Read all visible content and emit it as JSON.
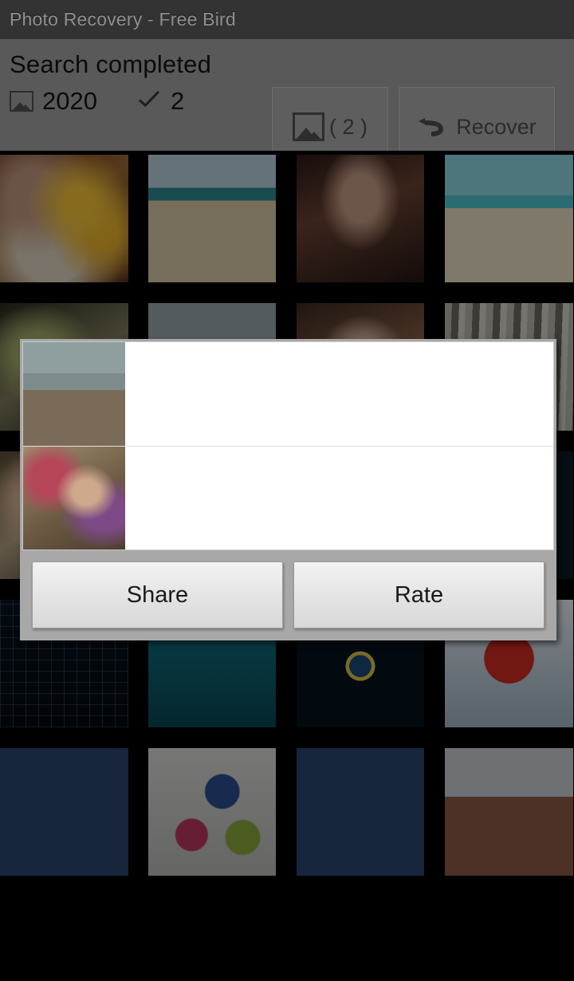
{
  "titlebar": {
    "title": "Photo Recovery - Free Bird"
  },
  "toolbar": {
    "status_line": "Search completed",
    "photo_icon": "image-icon",
    "photo_count": "2020",
    "check_icon": "check-icon",
    "selected_count": "2",
    "select_button": {
      "icon": "image-icon",
      "label": "( 2 )"
    },
    "recover_button": {
      "icon": "undo-arrow-icon",
      "label": "Recover"
    },
    "background_color": "#595959",
    "titlebar_color": "#333333"
  },
  "dialog": {
    "rows": [
      {
        "thumb_alt": "woman-in-black-dress-by-water",
        "text": ""
      },
      {
        "thumb_alt": "woman-reclining-indoors",
        "text": ""
      }
    ],
    "buttons": [
      {
        "label": "Share"
      },
      {
        "label": "Rate"
      }
    ],
    "frame_color": "#a8a8a8",
    "content_color": "#ffffff"
  },
  "grid": {
    "columns": 4,
    "cells": [
      {
        "alt": "mother-and-baby-autumn",
        "dimmed": false
      },
      {
        "alt": "woman-on-beach",
        "dimmed": false
      },
      {
        "alt": "woman-portrait-dark-hair",
        "dimmed": false
      },
      {
        "alt": "mother-and-baby-tropical-beach",
        "dimmed": false
      },
      {
        "alt": "blonde-woman-outdoors",
        "dimmed": true
      },
      {
        "alt": "woman-with-camera",
        "dimmed": true
      },
      {
        "alt": "woman-portrait-closeup",
        "dimmed": true
      },
      {
        "alt": "metal-pipes-texture",
        "dimmed": true
      },
      {
        "alt": "smiling-woman-portrait",
        "dimmed": true
      },
      {
        "alt": "woman-in-black-top",
        "dimmed": true
      },
      {
        "alt": "fitness-stats-1000-screen",
        "dimmed": true
      },
      {
        "alt": "app-icon-dark-globe-champion",
        "dimmed": true
      },
      {
        "alt": "signal-graph-screenshot",
        "dimmed": true
      },
      {
        "alt": "fitness-stats-938-screen",
        "dimmed": true
      },
      {
        "alt": "fitness-globe-dial-screen",
        "dimmed": true
      },
      {
        "alt": "china-railway-app-icon",
        "dimmed": true
      },
      {
        "alt": "music-note-app-icon",
        "dimmed": true
      },
      {
        "alt": "le-ka-fu-app-icon",
        "dimmed": true
      },
      {
        "alt": "music-note-app-icon-2",
        "dimmed": true
      },
      {
        "alt": "brick-architecture-photo",
        "dimmed": true
      }
    ]
  }
}
